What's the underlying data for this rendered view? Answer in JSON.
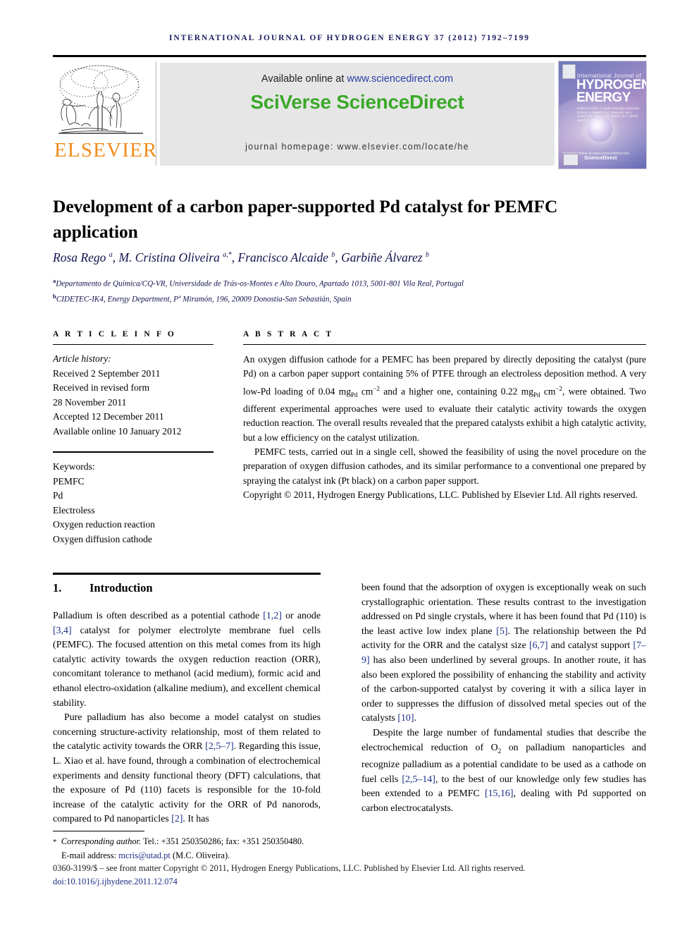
{
  "running_head": "International Journal of Hydrogen Energy 37 (2012) 7192–7199",
  "masthead": {
    "publisher_name": "ELSEVIER",
    "publisher_logo_alt": "elsevier-tree-logo",
    "available_online_prefix": "Available online at ",
    "available_online_url": "www.sciencedirect.com",
    "sciverse_logo": "SciVerse ScienceDirect",
    "journal_homepage": "journal homepage: www.elsevier.com/locate/he",
    "cover": {
      "line1": "International Journal of",
      "line2": "HYDROGEN",
      "line3": "ENERGY",
      "editors": "Editor-in-Chief: T. Nejat Veziroglu   Associate Editors: A. Bakshi, D.C. Brandon, M.A. Lewis, H.C. Maru, J.M. Ogden, S.A. Sherif and E.A. Ticianelli",
      "footer_note": "Available online at www.sciencedirect.com",
      "sciencedirect": "ScienceDirect",
      "badge_alt": "ijhe-logo-badge"
    }
  },
  "article": {
    "title": "Development of a carbon paper-supported Pd catalyst for PEMFC application",
    "authors_html": "Rosa Rego <sup>a</sup>, M. Cristina Oliveira <sup>a,*</sup>, Francisco Alcaide <sup>b</sup>, Garbiñe Álvarez <sup>b</sup>",
    "affiliations": [
      {
        "marker": "a",
        "text": "Departamento de Química/CQ-VR, Universidade de Trás-os-Montes e Alto Douro, Apartado 1013, 5001-801 Vila Real, Portugal"
      },
      {
        "marker": "b",
        "text": "CIDETEC-IK4, Energy Department, Pº Miramón, 196, 20009 Donostia-San Sebastián, Spain"
      }
    ]
  },
  "article_info": {
    "heading": "A R T I C L E   I N F O",
    "history_label": "Article history:",
    "history": [
      "Received 2 September 2011",
      "Received in revised form",
      "28 November 2011",
      "Accepted 12 December 2011",
      "Available online 10 January 2012"
    ],
    "keywords_label": "Keywords:",
    "keywords": [
      "PEMFC",
      "Pd",
      "Electroless",
      "Oxygen reduction reaction",
      "Oxygen diffusion cathode"
    ]
  },
  "abstract": {
    "heading": "A B S T R A C T",
    "paragraph1_html": "An oxygen diffusion cathode for a PEMFC has been prepared by directly depositing the catalyst (pure Pd) on a carbon paper support containing 5% of PTFE through an electroless deposition method. A very low-Pd loading of 0.04 mg<sub class=\"sm\">Pd</sub> cm<sup class=\"sm\">−2</sup> and a higher one, containing 0.22 mg<sub class=\"sm\">Pd</sub> cm<sup class=\"sm\">−2</sup>, were obtained. Two different experimental approaches were used to evaluate their catalytic activity towards the oxygen reduction reaction. The overall results revealed that the prepared catalysts exhibit a high catalytic activity, but a low efficiency on the catalyst utilization.",
    "paragraph2": "PEMFC tests, carried out in a single cell, showed the feasibility of using the novel procedure on the preparation of oxygen diffusion cathodes, and its similar performance to a conventional one prepared by spraying the catalyst ink (Pt black) on a carbon paper support.",
    "copyright": "Copyright © 2011, Hydrogen Energy Publications, LLC. Published by Elsevier Ltd. All rights reserved."
  },
  "section": {
    "number": "1.",
    "title": "Introduction"
  },
  "body": {
    "left_paragraphs_html": [
      "Palladium is often described as a potential cathode <span class=\"ref\">[1,2]</span> or anode <span class=\"ref\">[3,4]</span> catalyst for polymer electrolyte membrane fuel cells (PEMFC). The focused attention on this metal comes from its high catalytic activity towards the oxygen reduction reaction (ORR), concomitant tolerance to methanol (acid medium), formic acid and ethanol electro-oxidation (alkaline medium), and excellent chemical stability.",
      "Pure palladium has also become a model catalyst on studies concerning structure-activity relationship, most of them related to the catalytic activity towards the ORR <span class=\"ref\">[2,5–7]</span>. Regarding this issue, L. Xiao et al. have found, through a combination of electrochemical experiments and density functional theory (DFT) calculations, that the exposure of Pd (110) facets is responsible for the 10-fold increase of the catalytic activity for the ORR of Pd nanorods, compared to Pd nanoparticles <span class=\"ref\">[2]</span>. It has"
    ],
    "right_paragraphs_html": [
      "been found that the adsorption of oxygen is exceptionally weak on such crystallographic orientation. These results contrast to the investigation addressed on Pd single crystals, where it has been found that Pd (110) is the least active low index plane <span class=\"ref\">[5]</span>. The relationship between the Pd activity for the ORR and the catalyst size <span class=\"ref\">[6,7]</span> and catalyst support <span class=\"ref\">[7–9]</span> has also been underlined by several groups. In another route, it has also been explored the possibility of enhancing the stability and activity of the carbon-supported catalyst by covering it with a silica layer in order to suppresses the diffusion of dissolved metal species out of the catalysts <span class=\"ref\">[10]</span>.",
      "Despite the large number of fundamental studies that describe the electrochemical reduction of O<sub class=\"sm\">2</sub> on palladium nanoparticles and recognize palladium as a potential candidate to be used as a cathode on fuel cells <span class=\"ref\">[2,5–14]</span>, to the best of our knowledge only few studies has been extended to a PEMFC <span class=\"ref\">[15,16]</span>, dealing with Pd supported on carbon electrocatalysts."
    ]
  },
  "footnote": {
    "corresponding_html": "<span class=\"star\">*</span>&nbsp; <i>Corresponding author.</i> Tel.: +351 250350286; fax: +351 250350480.",
    "email_label": "E-mail address:",
    "email": "mcris@utad.pt",
    "email_owner": "(M.C. Oliveira)."
  },
  "imprint": {
    "line1": "0360-3199/$ – see front matter Copyright © 2011, Hydrogen Energy Publications, LLC. Published by Elsevier Ltd. All rights reserved.",
    "doi": "doi:10.1016/j.ijhydene.2011.12.074"
  },
  "colors": {
    "running_head": "#1a1a5e",
    "elsevier_orange": "#f08c1b",
    "sciencedirect_green": "#3aa929",
    "link_blue": "#2c3fa8",
    "reference_blue": "#1b2f86",
    "banner_gray": "#e6e6e6"
  }
}
